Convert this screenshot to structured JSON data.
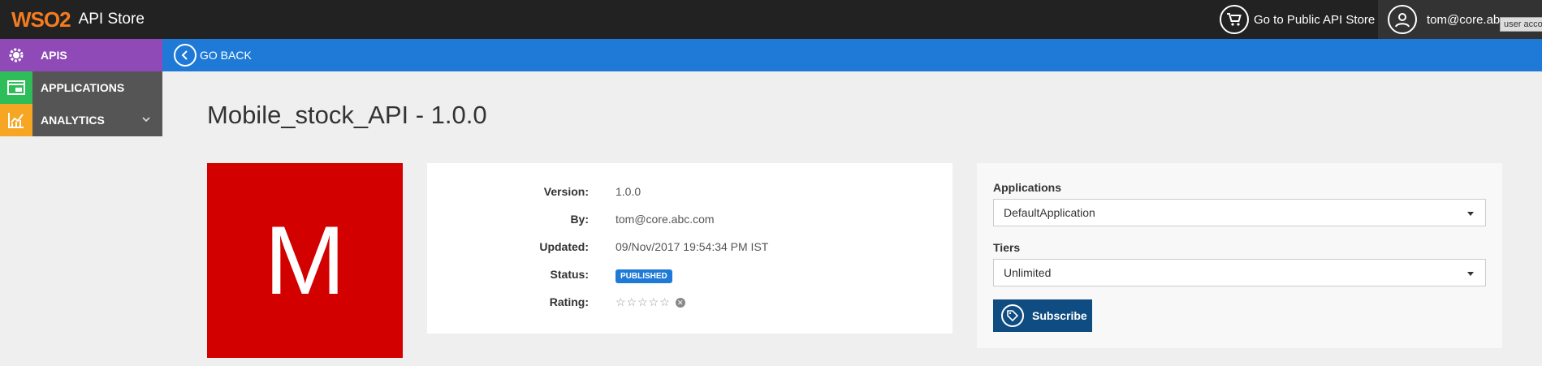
{
  "header": {
    "logo_text": "WSO2",
    "app_title": "API Store",
    "public_store_link": "Go to Public API Store",
    "user_name": "tom@core.abc.com",
    "user_tooltip": "user acco"
  },
  "sidebar": {
    "items": [
      {
        "label": "APIS",
        "icon": "apis-gear-icon",
        "color": "#8f4ab8",
        "active": true
      },
      {
        "label": "APPLICATIONS",
        "icon": "applications-icon",
        "color": "#2ebd59",
        "active": false
      },
      {
        "label": "ANALYTICS",
        "icon": "analytics-chart-icon",
        "color": "#f6a623",
        "active": false
      }
    ]
  },
  "navbar": {
    "back_label": "GO BACK",
    "color": "#1e7ad6"
  },
  "api": {
    "title": "Mobile_stock_API - 1.0.0",
    "thumbnail_letter": "M",
    "thumbnail_color": "#d30000",
    "details": {
      "version_label": "Version:",
      "version": "1.0.0",
      "by_label": "By:",
      "by": "tom@core.abc.com",
      "updated_label": "Updated:",
      "updated": "09/Nov/2017 19:54:34 PM IST",
      "status_label": "Status:",
      "status": "PUBLISHED",
      "rating_label": "Rating:",
      "rating": 0,
      "rating_max": 5
    }
  },
  "subscribe": {
    "applications_label": "Applications",
    "application_selected": "DefaultApplication",
    "tiers_label": "Tiers",
    "tier_selected": "Unlimited",
    "button_label": "Subscribe",
    "button_color": "#0f4c81"
  }
}
